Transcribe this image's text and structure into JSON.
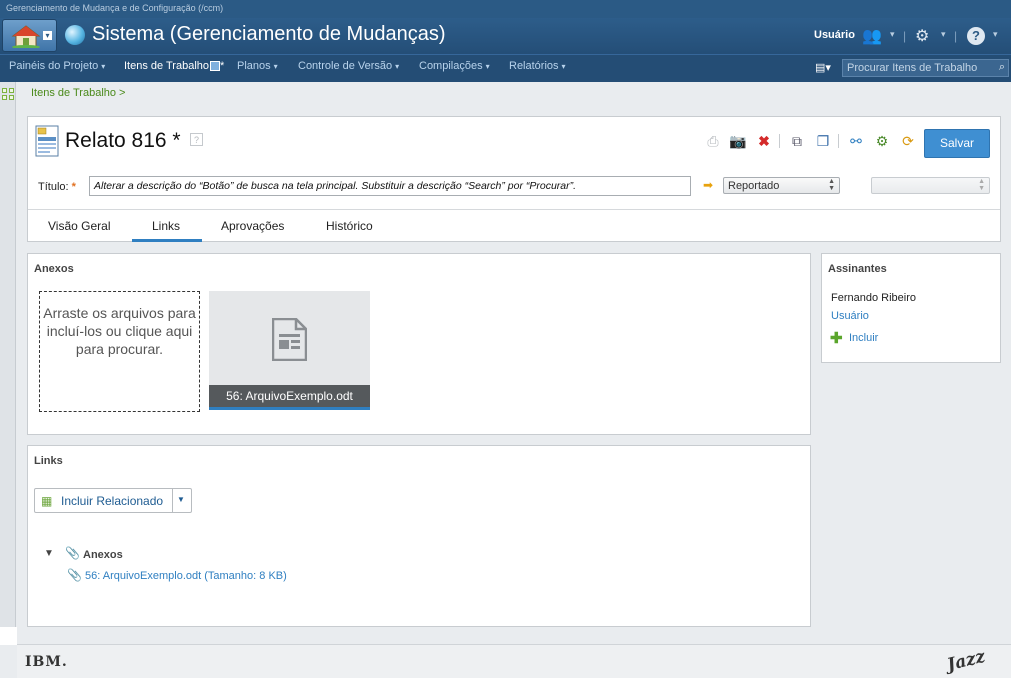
{
  "window": {
    "subtitle": "Gerenciamento de Mudança e de Configuração (/ccm)"
  },
  "header": {
    "app_title": "Sistema (Gerenciamento de Mudanças)",
    "user_label": "Usuário",
    "user_icon": "users-icon",
    "settings_icon": "gear-icon",
    "help_icon": "help-icon"
  },
  "nav": {
    "items": [
      {
        "label": "Painéis do Projeto"
      },
      {
        "label": "Itens de Trabalho",
        "active": true,
        "marker": "*"
      },
      {
        "label": "Planos"
      },
      {
        "label": "Controle de Versão"
      },
      {
        "label": "Compilações"
      },
      {
        "label": "Relatórios"
      }
    ],
    "search_placeholder": "Procurar Itens de Trabalho"
  },
  "breadcrumb": "Itens de Trabalho >",
  "editor": {
    "title": "Relato 816 *",
    "help": "?",
    "save_label": "Salvar",
    "title_label": "Título:",
    "required_mark": "*",
    "title_value": "Alterar a descrição do “Botão” de busca na tela principal. Substituir a descrição “Search” por “Procurar”.",
    "state": "Reportado",
    "tabs": [
      "Visão Geral",
      "Links",
      "Aprovações",
      "Histórico"
    ],
    "active_tab": "Links"
  },
  "attachments": {
    "title": "Anexos",
    "dropzone": "Arraste os arquivos para incluí-los ou clique aqui para procurar.",
    "file_caption": "56: ArquivoExemplo.odt"
  },
  "links": {
    "title": "Links",
    "add_related_label": "Incluir Relacionado",
    "tree_group": "Anexos",
    "tree_item": "56: ArquivoExemplo.odt (Tamanho: 8 KB)"
  },
  "subscribers": {
    "title": "Assinantes",
    "person": "Fernando Ribeiro",
    "role": "Usuário",
    "add_label": "Incluir"
  },
  "footer": {
    "ibm": "IBM.",
    "jazz": "Jazz"
  },
  "colors": {
    "accent": "#2f7fc1",
    "header": "#244d75",
    "save": "#3f8fd2",
    "required": "#e07020"
  }
}
